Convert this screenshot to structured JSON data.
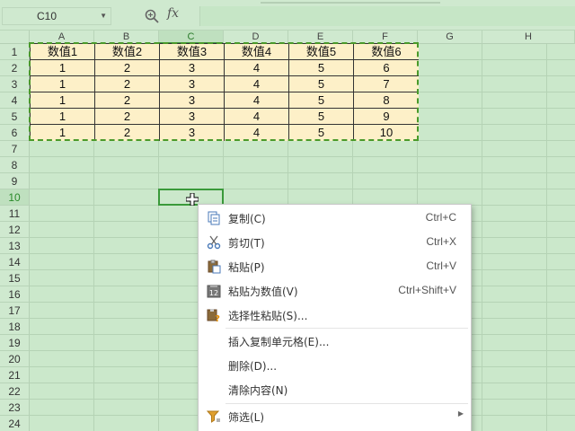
{
  "name_box": {
    "value": "C10"
  },
  "formula_bar": {
    "fx_label": "fx"
  },
  "columns": [
    "A",
    "B",
    "C",
    "D",
    "E",
    "F",
    "G",
    "H"
  ],
  "selected_column": "C",
  "rows": [
    "1",
    "2",
    "3",
    "4",
    "5",
    "6",
    "7",
    "8",
    "9",
    "10",
    "11",
    "12",
    "13",
    "14",
    "15",
    "16",
    "17",
    "18",
    "19",
    "20",
    "21",
    "22",
    "23",
    "24"
  ],
  "selected_row": "10",
  "table": {
    "headers": [
      "数值1",
      "数值2",
      "数值3",
      "数值4",
      "数值5",
      "数值6"
    ],
    "rows": [
      [
        "1",
        "2",
        "3",
        "4",
        "5",
        "6"
      ],
      [
        "1",
        "2",
        "3",
        "4",
        "5",
        "7"
      ],
      [
        "1",
        "2",
        "3",
        "4",
        "5",
        "8"
      ],
      [
        "1",
        "2",
        "3",
        "4",
        "5",
        "9"
      ],
      [
        "1",
        "2",
        "3",
        "4",
        "5",
        "10"
      ]
    ]
  },
  "context_menu": {
    "items": [
      {
        "label": "复制(C)",
        "shortcut": "Ctrl+C",
        "icon": "copy-icon"
      },
      {
        "label": "剪切(T)",
        "shortcut": "Ctrl+X",
        "icon": "scissors-icon"
      },
      {
        "label": "粘贴(P)",
        "shortcut": "Ctrl+V",
        "icon": "paste-icon"
      },
      {
        "label": "粘贴为数值(V)",
        "shortcut": "Ctrl+Shift+V",
        "icon": "paste-values-icon"
      },
      {
        "label": "选择性粘贴(S)...",
        "shortcut": "",
        "icon": "paste-special-icon"
      },
      {
        "label": "插入复制单元格(E)...",
        "shortcut": "",
        "icon": ""
      },
      {
        "label": "删除(D)...",
        "shortcut": "",
        "icon": ""
      },
      {
        "label": "清除内容(N)",
        "shortcut": "",
        "icon": ""
      },
      {
        "label": "筛选(L)",
        "shortcut": "",
        "icon": "filter-icon",
        "submenu": true
      }
    ]
  },
  "colors": {
    "sheet_bg": "#cbe8cb",
    "data_fill": "#fdf0c8",
    "accent": "#3a9a3a"
  }
}
